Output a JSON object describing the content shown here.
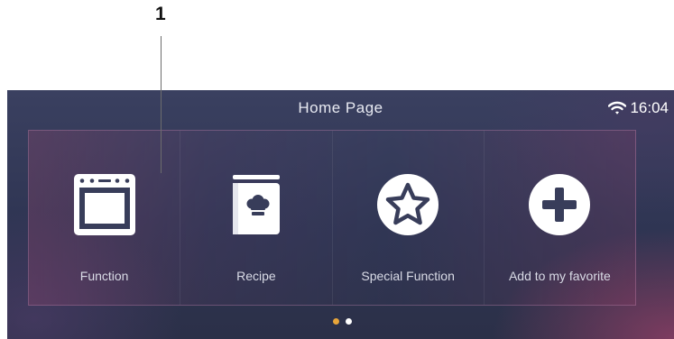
{
  "callout": {
    "number": "1"
  },
  "header": {
    "title": "Home Page",
    "time": "16:04"
  },
  "tiles": [
    {
      "label": "Function",
      "icon": "oven-icon"
    },
    {
      "label": "Recipe",
      "icon": "recipe-book-icon"
    },
    {
      "label": "Special Function",
      "icon": "star-icon"
    },
    {
      "label": "Add to my favorite",
      "icon": "plus-icon"
    }
  ],
  "pager": {
    "pages": 2,
    "current": 1
  },
  "colors": {
    "accent": "#e8a53a",
    "background": "#2f3553",
    "text": "#ffffff"
  }
}
